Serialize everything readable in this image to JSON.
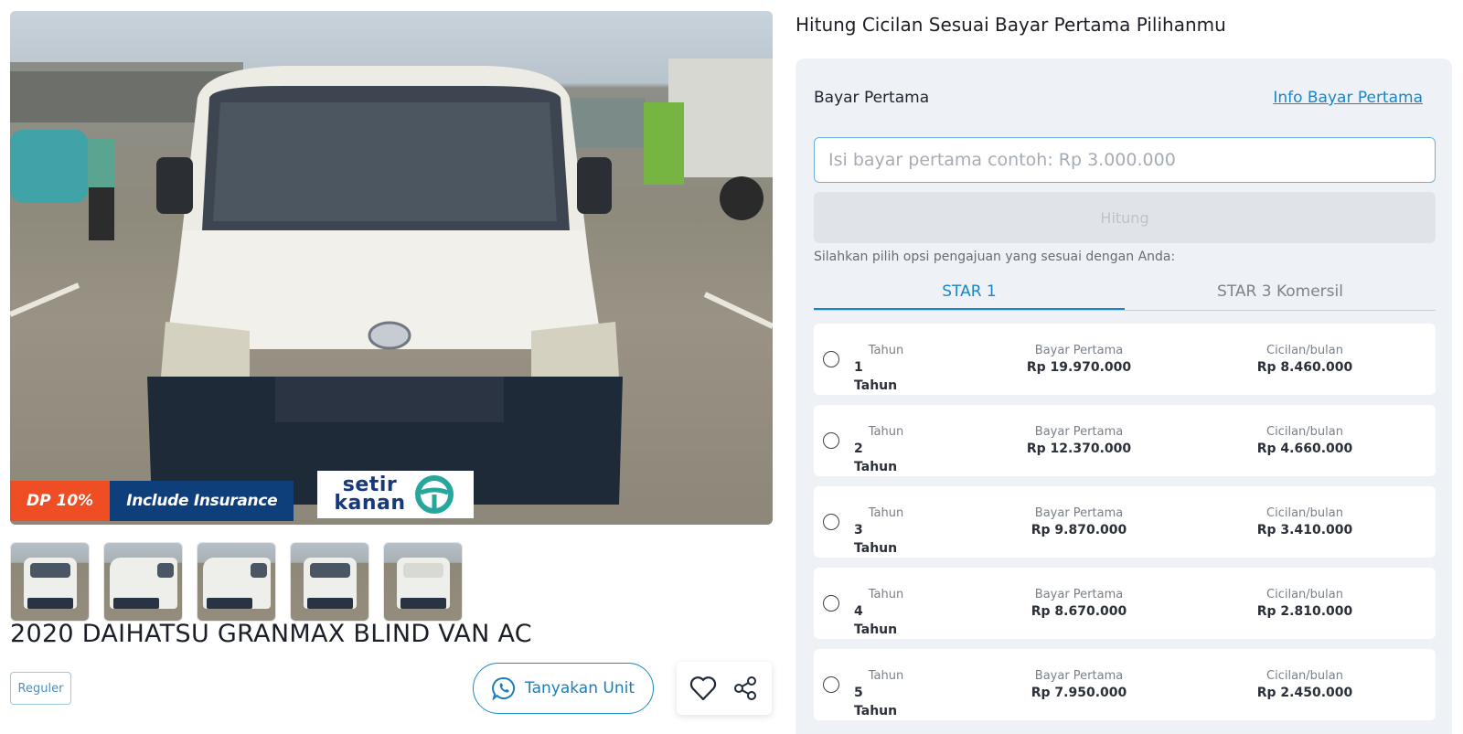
{
  "hero": {
    "badge_dp": "DP 10%",
    "badge_insurance": "Include Insurance",
    "brand_line1": "setir",
    "brand_line2": "kanan"
  },
  "product": {
    "title": "2020 DAIHATSU GRANMAX BLIND VAN AC",
    "tag": "Reguler",
    "ask_button": "Tanyakan Unit"
  },
  "calculator": {
    "section_title": "Hitung Cicilan Sesuai Bayar Pertama Pilihanmu",
    "dp_label": "Bayar Pertama",
    "info_link": "Info Bayar Pertama",
    "dp_placeholder": "Isi bayar pertama contoh: Rp 3.000.000",
    "calc_button": "Hitung",
    "hint": "Silahkan pilih opsi pengajuan yang sesuai dengan Anda:",
    "tabs": [
      {
        "label": "STAR 1"
      },
      {
        "label": "STAR 3 Komersil"
      }
    ],
    "col_labels": {
      "years": "Tahun",
      "dp": "Bayar Pertama",
      "installment": "Cicilan/bulan"
    },
    "options": [
      {
        "years": "1 Tahun",
        "dp": "Rp 19.970.000",
        "installment": "Rp 8.460.000"
      },
      {
        "years": "2 Tahun",
        "dp": "Rp 12.370.000",
        "installment": "Rp 4.660.000"
      },
      {
        "years": "3 Tahun",
        "dp": "Rp 9.870.000",
        "installment": "Rp 3.410.000"
      },
      {
        "years": "4 Tahun",
        "dp": "Rp 8.670.000",
        "installment": "Rp 2.810.000"
      },
      {
        "years": "5 Tahun",
        "dp": "Rp 7.950.000",
        "installment": "Rp 2.450.000"
      }
    ]
  },
  "colors": {
    "accent": "#1a86c8",
    "dp_badge": "#ef4d23",
    "insurance_badge": "#0f3f7a",
    "panel_bg": "#eef2f6"
  },
  "icons": [
    "whatsapp-icon",
    "heart-icon",
    "share-icon"
  ]
}
